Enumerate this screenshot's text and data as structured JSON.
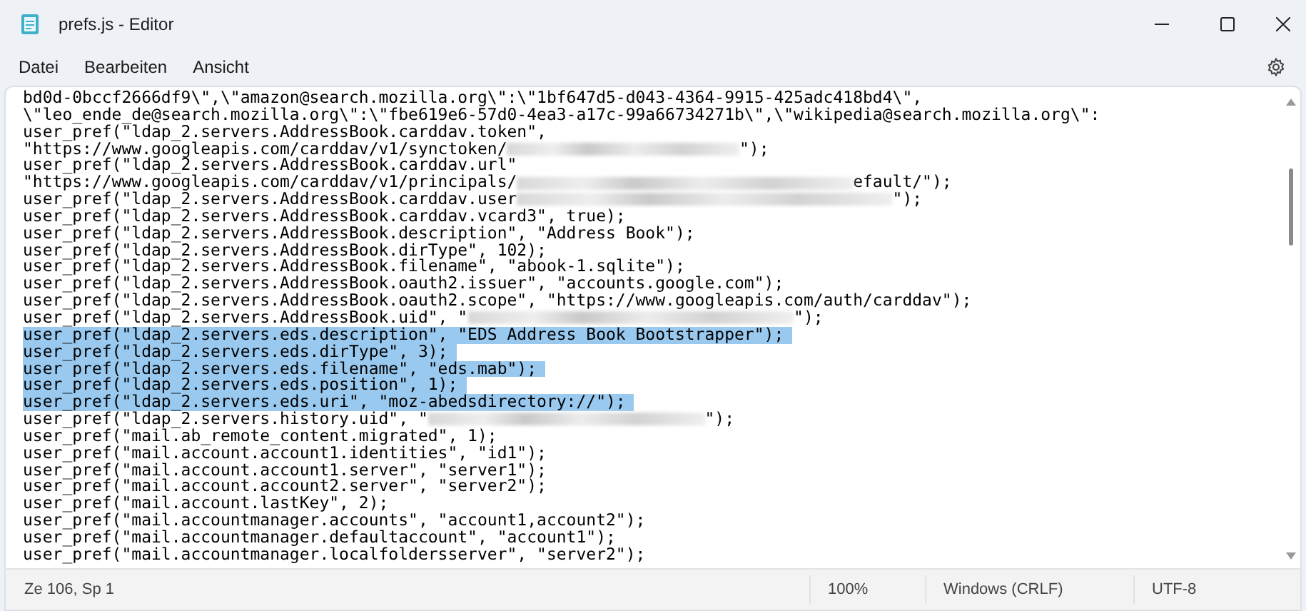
{
  "window": {
    "title": "prefs.js - Editor"
  },
  "menu": [
    "Datei",
    "Bearbeiten",
    "Ansicht"
  ],
  "editor": {
    "lines": [
      {
        "selected": false,
        "segments": [
          {
            "kind": "text",
            "text": "bd0d-0bccf2666df9\\\",\\\"amazon@search.mozilla.org\\\":\\\"1bf647d5-d043-4364-9915-425adc418bd4\\\","
          }
        ]
      },
      {
        "selected": false,
        "segments": [
          {
            "kind": "text",
            "text": "\\\"leo_ende_de@search.mozilla.org\\\":\\\"fbe619e6-57d0-4ea3-a17c-99a66734271b\\\",\\\"wikipedia@search.mozilla.org\\\":"
          }
        ]
      },
      {
        "selected": false,
        "segments": [
          {
            "kind": "text",
            "text": "user_pref(\"ldap_2.servers.AddressBook.carddav.token\","
          }
        ]
      },
      {
        "selected": false,
        "segments": [
          {
            "kind": "text",
            "text": "\"https://www.googleapis.com/carddav/v1/synctoken/"
          },
          {
            "kind": "redacted"
          },
          {
            "kind": "text",
            "text": "\");"
          }
        ]
      },
      {
        "selected": false,
        "segments": [
          {
            "kind": "text",
            "text": "user_pref(\"ldap_2.servers.AddressBook.carddav.url\""
          }
        ]
      },
      {
        "selected": false,
        "segments": [
          {
            "kind": "text",
            "text": "\"https://www.googleapis.com/carddav/v1/principals/"
          },
          {
            "kind": "redacted"
          },
          {
            "kind": "text",
            "text": "efault/\");"
          }
        ]
      },
      {
        "selected": false,
        "segments": [
          {
            "kind": "text",
            "text": "user_pref(\"ldap_2.servers.AddressBook.carddav.user"
          },
          {
            "kind": "redacted"
          },
          {
            "kind": "text",
            "text": "\");"
          }
        ]
      },
      {
        "selected": false,
        "segments": [
          {
            "kind": "text",
            "text": "user_pref(\"ldap_2.servers.AddressBook.carddav.vcard3\", true);"
          }
        ]
      },
      {
        "selected": false,
        "segments": [
          {
            "kind": "text",
            "text": "user_pref(\"ldap_2.servers.AddressBook.description\", \"Address Book\");"
          }
        ]
      },
      {
        "selected": false,
        "segments": [
          {
            "kind": "text",
            "text": "user_pref(\"ldap_2.servers.AddressBook.dirType\", 102);"
          }
        ]
      },
      {
        "selected": false,
        "segments": [
          {
            "kind": "text",
            "text": "user_pref(\"ldap_2.servers.AddressBook.filename\", \"abook-1.sqlite\");"
          }
        ]
      },
      {
        "selected": false,
        "segments": [
          {
            "kind": "text",
            "text": "user_pref(\"ldap_2.servers.AddressBook.oauth2.issuer\", \"accounts.google.com\");"
          }
        ]
      },
      {
        "selected": false,
        "segments": [
          {
            "kind": "text",
            "text": "user_pref(\"ldap_2.servers.AddressBook.oauth2.scope\", \"https://www.googleapis.com/auth/carddav\");"
          }
        ]
      },
      {
        "selected": false,
        "segments": [
          {
            "kind": "text",
            "text": "user_pref(\"ldap_2.servers.AddressBook.uid\", \""
          },
          {
            "kind": "redacted"
          },
          {
            "kind": "text",
            "text": "\");"
          }
        ]
      },
      {
        "selected": true,
        "segments": [
          {
            "kind": "text",
            "text": "user_pref(\"ldap_2.servers.eds.description\", \"EDS Address Book Bootstrapper\");"
          }
        ]
      },
      {
        "selected": true,
        "segments": [
          {
            "kind": "text",
            "text": "user_pref(\"ldap_2.servers.eds.dirType\", 3);"
          }
        ]
      },
      {
        "selected": true,
        "segments": [
          {
            "kind": "text",
            "text": "user_pref(\"ldap_2.servers.eds.filename\", \"eds.mab\");"
          }
        ]
      },
      {
        "selected": true,
        "segments": [
          {
            "kind": "text",
            "text": "user_pref(\"ldap_2.servers.eds.position\", 1);"
          }
        ]
      },
      {
        "selected": true,
        "segments": [
          {
            "kind": "text",
            "text": "user_pref(\"ldap_2.servers.eds.uri\", \"moz-abedsdirectory://\");"
          }
        ]
      },
      {
        "selected": false,
        "segments": [
          {
            "kind": "text",
            "text": "user_pref(\"ldap_2.servers.history.uid\", \""
          },
          {
            "kind": "redacted"
          },
          {
            "kind": "text",
            "text": "\");"
          }
        ]
      },
      {
        "selected": false,
        "segments": [
          {
            "kind": "text",
            "text": "user_pref(\"mail.ab_remote_content.migrated\", 1);"
          }
        ]
      },
      {
        "selected": false,
        "segments": [
          {
            "kind": "text",
            "text": "user_pref(\"mail.account.account1.identities\", \"id1\");"
          }
        ]
      },
      {
        "selected": false,
        "segments": [
          {
            "kind": "text",
            "text": "user_pref(\"mail.account.account1.server\", \"server1\");"
          }
        ]
      },
      {
        "selected": false,
        "segments": [
          {
            "kind": "text",
            "text": "user_pref(\"mail.account.account2.server\", \"server2\");"
          }
        ]
      },
      {
        "selected": false,
        "segments": [
          {
            "kind": "text",
            "text": "user_pref(\"mail.account.lastKey\", 2);"
          }
        ]
      },
      {
        "selected": false,
        "segments": [
          {
            "kind": "text",
            "text": "user_pref(\"mail.accountmanager.accounts\", \"account1,account2\");"
          }
        ]
      },
      {
        "selected": false,
        "segments": [
          {
            "kind": "text",
            "text": "user_pref(\"mail.accountmanager.defaultaccount\", \"account1\");"
          }
        ]
      },
      {
        "selected": false,
        "segments": [
          {
            "kind": "text",
            "text": "user_pref(\"mail.accountmanager.localfoldersserver\", \"server2\");"
          }
        ]
      }
    ]
  },
  "status_bar": {
    "position": "Ze 106, Sp 1",
    "zoom": "100%",
    "line_endings": "Windows (CRLF)",
    "encoding": "UTF-8"
  }
}
